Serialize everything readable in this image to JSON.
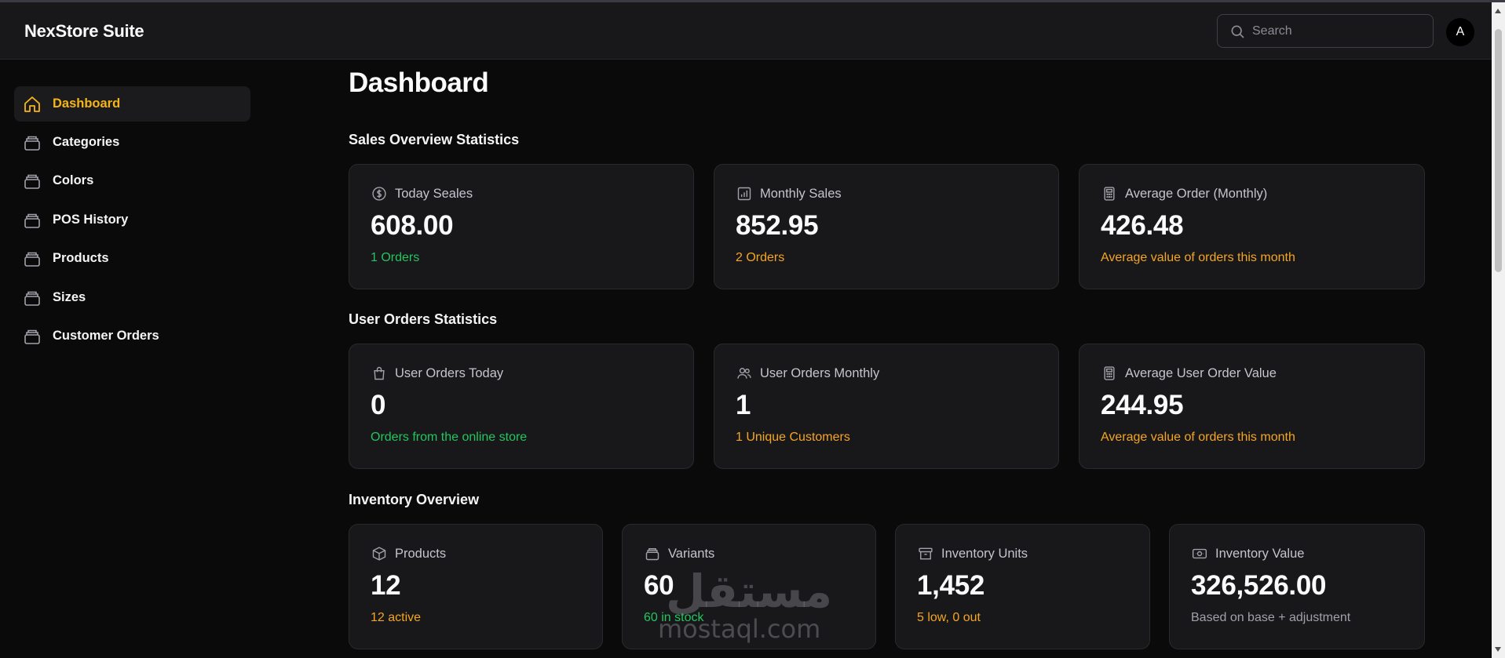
{
  "app": {
    "brand": "NexStore Suite"
  },
  "search": {
    "placeholder": "Search"
  },
  "user": {
    "avatar_initial": "A"
  },
  "sidebar": {
    "items": [
      {
        "label": "Dashboard",
        "icon": "home-icon",
        "active": true
      },
      {
        "label": "Categories",
        "icon": "box-icon"
      },
      {
        "label": "Colors",
        "icon": "box-icon"
      },
      {
        "label": "POS History",
        "icon": "box-icon"
      },
      {
        "label": "Products",
        "icon": "box-icon"
      },
      {
        "label": "Sizes",
        "icon": "box-icon"
      },
      {
        "label": "Customer Orders",
        "icon": "box-icon"
      }
    ]
  },
  "page": {
    "title": "Dashboard"
  },
  "sections": {
    "sales": {
      "title": "Sales Overview Statistics",
      "cards": [
        {
          "label": "Today Seales",
          "value": "608.00",
          "sub": "1 Orders",
          "icon": "dollar-icon",
          "sub_color": "green"
        },
        {
          "label": "Monthly Sales",
          "value": "852.95",
          "sub": "2 Orders",
          "icon": "bar-chart-icon",
          "sub_color": "amber"
        },
        {
          "label": "Average Order (Monthly)",
          "value": "426.48",
          "sub": "Average value of orders this month",
          "icon": "calculator-icon",
          "sub_color": "amber"
        }
      ]
    },
    "user_orders": {
      "title": "User Orders Statistics",
      "cards": [
        {
          "label": "User Orders Today",
          "value": "0",
          "sub": "Orders from the online store",
          "icon": "shopping-bag-icon",
          "sub_color": "green"
        },
        {
          "label": "User Orders Monthly",
          "value": "1",
          "sub": "1 Unique Customers",
          "icon": "users-icon",
          "sub_color": "amber"
        },
        {
          "label": "Average User Order Value",
          "value": "244.95",
          "sub": "Average value of orders this month",
          "icon": "calculator-icon",
          "sub_color": "amber"
        }
      ]
    },
    "inventory": {
      "title": "Inventory Overview",
      "cards": [
        {
          "label": "Products",
          "value": "12",
          "sub": "12 active",
          "icon": "package-icon",
          "sub_color": "amber"
        },
        {
          "label": "Variants",
          "value": "60",
          "sub": "60 in stock",
          "icon": "box-icon",
          "sub_color": "green"
        },
        {
          "label": "Inventory Units",
          "value": "1,452",
          "sub": "5 low, 0 out",
          "icon": "archive-icon",
          "sub_color": "amber"
        },
        {
          "label": "Inventory Value",
          "value": "326,526.00",
          "sub": "Based on base + adjustment",
          "icon": "banknote-icon",
          "sub_color": "gray"
        }
      ]
    }
  },
  "watermark": {
    "arabic": "مستقل",
    "latin": "mostaql.com"
  },
  "colors": {
    "accent": "#f5b419",
    "green": "#22c55e",
    "amber": "#f5a524",
    "background": "#0a0a0b",
    "card": "#18181b"
  }
}
